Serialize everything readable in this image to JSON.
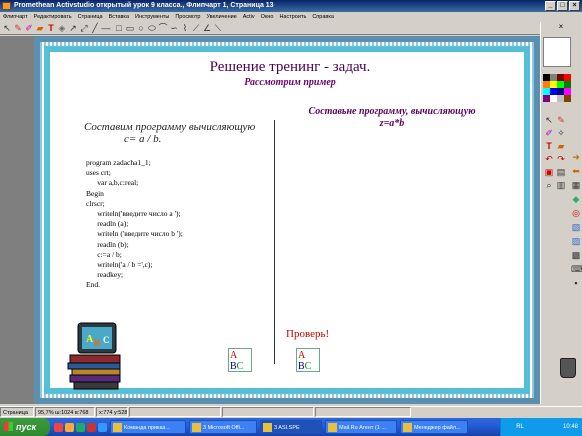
{
  "window": {
    "title": "Promethean Activstudio  открытый урок 9 класса., Флипчарт 1,  Страница 13"
  },
  "menu": [
    "Флипчарт",
    "Редактировать",
    "Страница",
    "Вставка",
    "Инструменты",
    "Просмотр",
    "Увеличение",
    "Activ",
    "Окно",
    "Настроить",
    "Справка"
  ],
  "slide": {
    "title": "Решение тренинг - задач.",
    "subtitle": "Рассмотрим пример",
    "left_task": "Составим программу вычисляющую",
    "left_formula": "c=  a / b.",
    "right_task_line1": "Составьне программу, вычисляющую",
    "right_task_line2": "z=a*b",
    "check_label": "Проверь!",
    "code_lines": [
      "program zadacha1_1;",
      "uses crt;",
      "      var a,b,c:real;",
      "Begin",
      "clrscr;",
      "      writeln('введите число a ');",
      "      readln (a);",
      "      writeln ('введите число b ');",
      "      readln (b);",
      "      c:=a / b;",
      "      writeln('a / b =',c);",
      "      readkey;",
      "End."
    ],
    "icon_letters": [
      "A",
      "B",
      "C"
    ]
  },
  "status": {
    "page_label": "Страница",
    "zoom_info": "95,7% ш:1024 в:768",
    "coords": "x:774 y:528"
  },
  "taskbar": {
    "start_label": "пуск",
    "tasks": [
      "Команда приказ...",
      "3 Microsoft Offi...",
      "3 ASI.SPE",
      "Mail.Ru Агент (1 ...",
      "Менеджер файл..."
    ],
    "tray_lang": "RL",
    "clock": "10:48"
  },
  "colors": {
    "title_color": "#4a0050",
    "frame_color": "#56bfd6",
    "check_color": "#c80000"
  }
}
